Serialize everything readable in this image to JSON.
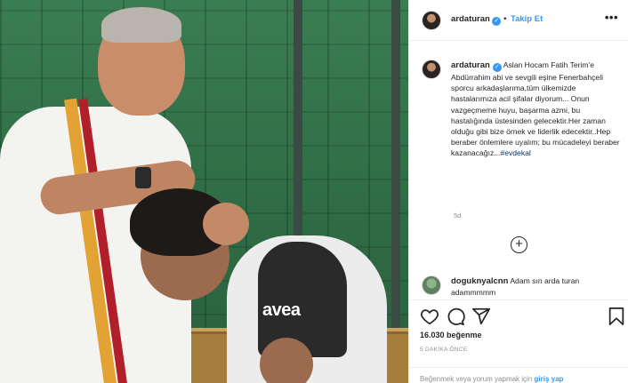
{
  "post": {
    "author": "ardaturan",
    "follow_label": "Takip Et",
    "more_label": "•••",
    "photo": {
      "sponsor_text": "avea",
      "description_icon": "photo-placeholder"
    }
  },
  "caption": {
    "username": "ardaturan",
    "text": "Aslan Hocam Fatih Terim'e Abdürrahim abi ve sevgili eşine Fenerbahçeli sporcu arkadaşlarıma,tüm ülkemizde hastalarımıza acil şifalar diyorum... Onun vazgeçmeme huyu, başarma azmi, bu hastalığında üstesinden gelecektir.Her zaman olduğu gibi bize örnek ve liderlik edecektir..Hep beraber önlemlere uyalım; bu mücadeleyi beraber kazanacağız...",
    "hashtag": "#evdekal",
    "age": "5d"
  },
  "load_more_label": "+",
  "comments": [
    {
      "username": "doguknyalcnn",
      "text": "Adam sın arda turan adammmmm"
    }
  ],
  "actions": {
    "like_icon": "heart-icon",
    "comment_icon": "comment-icon",
    "share_icon": "share-icon",
    "save_icon": "bookmark-icon"
  },
  "likes": "16.030 beğenme",
  "time_ago": "5 DAKİKA ÖNCE",
  "footer": {
    "text": "Beğenmek veya yorum yapmak için ",
    "login_label": "giriş yap"
  },
  "colors": {
    "accent": "#3897f0",
    "hashtag": "#00376b",
    "muted": "#8e8e8e"
  }
}
